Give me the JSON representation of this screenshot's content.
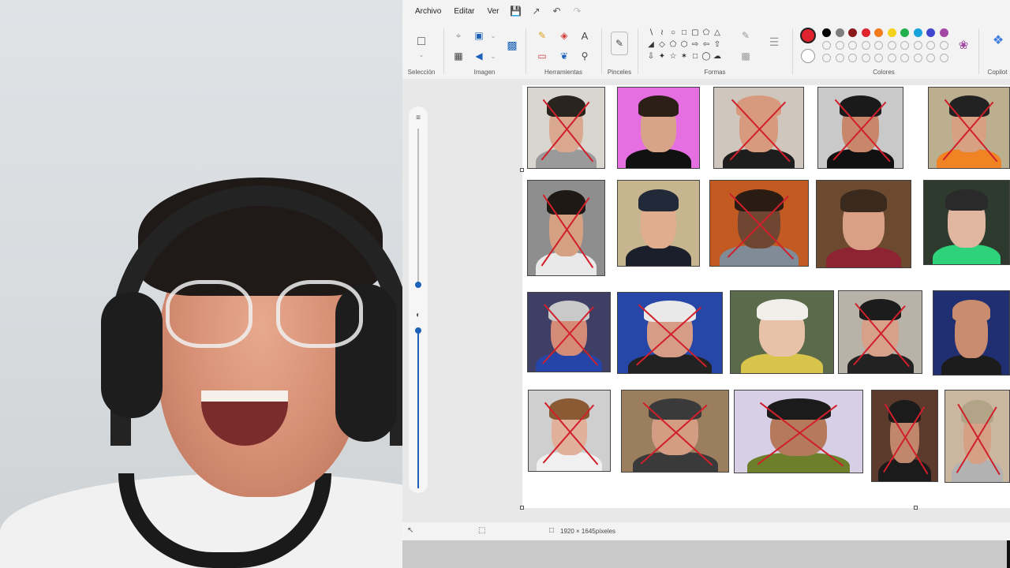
{
  "menubar": {
    "items": [
      {
        "label": "Archivo"
      },
      {
        "label": "Editar"
      },
      {
        "label": "Ver"
      }
    ]
  },
  "quick_access": [
    "save-icon",
    "share-icon",
    "undo-icon",
    "redo-icon"
  ],
  "ribbon": {
    "groups": {
      "seleccion": "Selección",
      "imagen": "Imagen",
      "herramientas": "Herramientas",
      "pinceles": "Pinceles",
      "formas": "Formas",
      "colores": "Colores",
      "copilot": "Copilot"
    }
  },
  "colors": {
    "primary": "#e0242f",
    "accent": "#1d62b8",
    "row1": [
      "#000000",
      "#7f7f7f",
      "#8b1a1a",
      "#e0242f",
      "#f07c1e",
      "#f5d21a",
      "#21b04b",
      "#17a2dd",
      "#3f48cc",
      "#a349a4"
    ],
    "row2": [
      "",
      "#c3c3c3",
      "#b97a57",
      "#ffaec9",
      "#f5c342",
      "#efe4b0",
      "#b5e61d",
      "#99d9ea",
      "#7092be",
      "#c8bfe7"
    ]
  },
  "statusbar": {
    "dimensions": "1920 × 1645píxeles"
  },
  "canvas": {
    "thumbnails": [
      {
        "bg": "#d9d6d0",
        "skin": "#d9a88f",
        "hair": "#2a241f",
        "body": "#9a9a9a",
        "crossed": true
      },
      {
        "bg": "#e56ee0",
        "skin": "#d8a489",
        "hair": "#2b1f18",
        "body": "#111111",
        "crossed": false
      },
      {
        "bg": "#cfc7bd",
        "skin": "#d79a7f",
        "hair": "#d79a7f",
        "body": "#1d1d1d",
        "crossed": true
      },
      {
        "bg": "#c9c9c9",
        "skin": "#c8876a",
        "hair": "#1a1a1a",
        "body": "#111111",
        "crossed": true
      },
      {
        "bg": "#bcaf8f",
        "skin": "#d7a083",
        "hair": "#222222",
        "body": "#f08424",
        "crossed": true
      },
      {
        "bg": "#8e8e8e",
        "skin": "#d6a183",
        "hair": "#1e1914",
        "body": "#e9e9e9",
        "crossed": true
      },
      {
        "bg": "#c6b58e",
        "skin": "#e0ad8f",
        "hair": "#222a3a",
        "body": "#1b1f2b",
        "crossed": false
      },
      {
        "bg": "#c25a22",
        "skin": "#6e4631",
        "hair": "#2a1c12",
        "body": "#7f8b97",
        "crossed": true
      },
      {
        "bg": "#6b4a2f",
        "skin": "#d9a086",
        "hair": "#3a2a1e",
        "body": "#8e2432",
        "crossed": false
      },
      {
        "bg": "#2f3a2e",
        "skin": "#e0b6a0",
        "hair": "#2a2a2a",
        "body": "#2ed27a",
        "crossed": false
      },
      {
        "bg": "#3f3f66",
        "skin": "#d48c78",
        "hair": "#c9c9c9",
        "body": "#2546a8",
        "crossed": true
      },
      {
        "bg": "#2646a8",
        "skin": "#d79c86",
        "hair": "#e9e9e9",
        "body": "#222222",
        "crossed": true
      },
      {
        "bg": "#5a6a4a",
        "skin": "#e7c2a9",
        "hair": "#f1efe9",
        "body": "#d8c44a",
        "crossed": false
      },
      {
        "bg": "#b8b2a8",
        "skin": "#d6a089",
        "hair": "#1c1c1c",
        "body": "#222222",
        "crossed": true
      },
      {
        "bg": "#1f2f72",
        "skin": "#c98c6e",
        "hair": "#c98c6e",
        "body": "#1c1c1c",
        "crossed": false
      },
      {
        "bg": "#cfcfcf",
        "skin": "#e1b09a",
        "hair": "#8a5a35",
        "body": "#f0f0f0",
        "crossed": true
      },
      {
        "bg": "#9a7e5e",
        "skin": "#d39c83",
        "hair": "#3a3a3a",
        "body": "#3a3a3a",
        "crossed": true
      },
      {
        "bg": "#d7cfe6",
        "skin": "#b57a5c",
        "hair": "#1b1b1b",
        "body": "#6d7f2a",
        "crossed": true
      },
      {
        "bg": "#5c3a2c",
        "skin": "#c1876c",
        "hair": "#1b1b1b",
        "body": "#1b1b1b",
        "crossed": true
      },
      {
        "bg": "#cbb6a0",
        "skin": "#d5a086",
        "hair": "#b2a486",
        "body": "#b2b2b2",
        "crossed": true
      }
    ]
  }
}
